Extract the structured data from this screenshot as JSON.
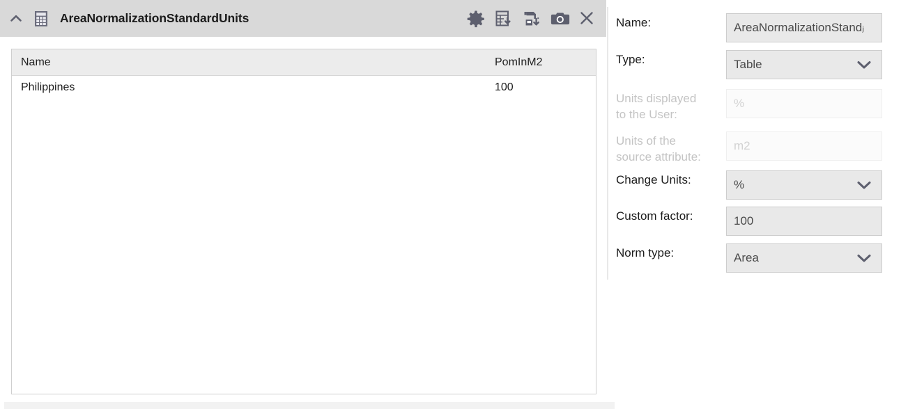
{
  "panel": {
    "title": "AreaNormalizationStandardUnits",
    "collapse_icon": "chevron-up-icon",
    "type_icon": "table-grid-icon",
    "tools": [
      {
        "name": "settings-gear-icon",
        "label": "Settings"
      },
      {
        "name": "export-table-icon",
        "label": "Export table"
      },
      {
        "name": "save-data-icon",
        "label": "Save data"
      },
      {
        "name": "camera-snapshot-icon",
        "label": "Snapshot"
      },
      {
        "name": "close-icon",
        "label": "Close"
      }
    ]
  },
  "table": {
    "columns": [
      "Name",
      "PomInM2"
    ],
    "rows": [
      {
        "name": "Philippines",
        "value": "100"
      }
    ]
  },
  "form": {
    "name": {
      "label": "Name:",
      "value": "AreaNormalizationStandⱼ",
      "full_value": "AreaNormalizationStandardUnits",
      "disabled": false
    },
    "type": {
      "label": "Type:",
      "value": "Table",
      "disabled": false,
      "options": [
        "Table"
      ]
    },
    "units_displayed": {
      "label": "Units displayed to the User:",
      "label_line1": "Units displayed",
      "label_line2": "to the User:",
      "value": "%",
      "disabled": true
    },
    "units_source": {
      "label": "Units of the source attribute:",
      "label_line1": "Units of the",
      "label_line2": "source attribute:",
      "value": "m2",
      "disabled": true
    },
    "change_units": {
      "label": "Change Units:",
      "value": "%",
      "disabled": false,
      "options": [
        "%"
      ]
    },
    "custom_factor": {
      "label": "Custom factor:",
      "value": "100",
      "disabled": false
    },
    "norm_type": {
      "label": "Norm type:",
      "value": "Area",
      "disabled": false,
      "options": [
        "Area"
      ]
    }
  },
  "colors": {
    "header_bar": "#d9d9d9",
    "field_bg": "#e9e9e9",
    "field_border": "#cdcdcd",
    "disabled_text": "#d2d2d2",
    "icon": "#5d5f6e",
    "table_header_bg": "#ececec"
  }
}
